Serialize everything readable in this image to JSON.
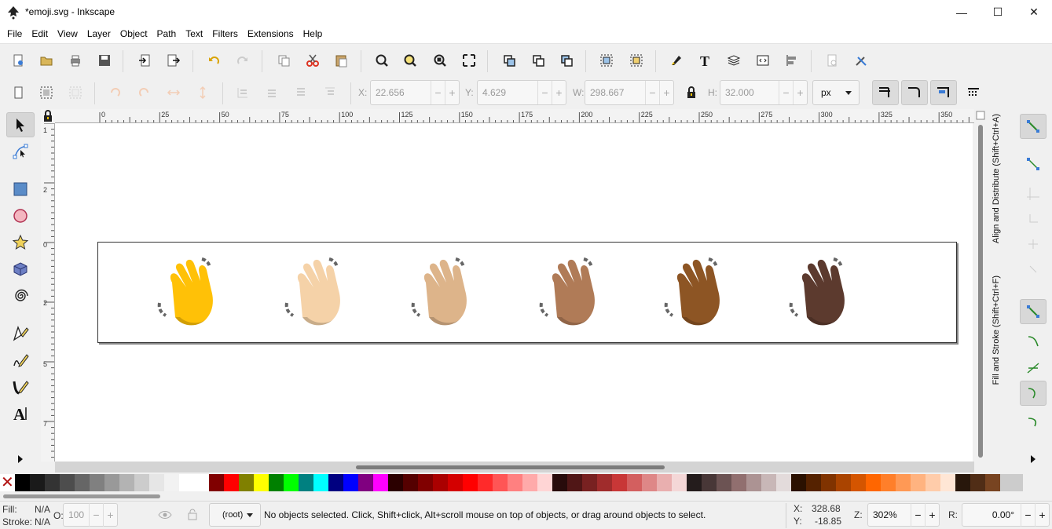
{
  "window": {
    "title": "*emoji.svg - Inkscape",
    "minimize_glyph": "—",
    "maximize_glyph": "☐",
    "close_glyph": "✕"
  },
  "menu": [
    "File",
    "Edit",
    "View",
    "Layer",
    "Object",
    "Path",
    "Text",
    "Filters",
    "Extensions",
    "Help"
  ],
  "controls": {
    "x": {
      "label": "X:",
      "value": "22.656"
    },
    "y": {
      "label": "Y:",
      "value": "4.629"
    },
    "w": {
      "label": "W:",
      "value": "298.667"
    },
    "h": {
      "label": "H:",
      "value": "32.000"
    },
    "unit": "px",
    "minus": "−",
    "plus": "+"
  },
  "ruler_top_labels": [
    "0",
    "25",
    "50",
    "75",
    "100",
    "125",
    "150",
    "175",
    "200",
    "225",
    "250",
    "275",
    "300",
    "325",
    "350"
  ],
  "ruler_left_labels": [
    "1",
    "2",
    "0",
    "2",
    "5",
    "7"
  ],
  "canvas": {
    "emoji_count": 6,
    "skin_tones": [
      "#FFC107",
      "#F5D2A8",
      "#DDB48A",
      "#B07B57",
      "#8D5524",
      "#5C3A2E"
    ]
  },
  "dock_tabs": {
    "align": "Align and Distribute (Shift+Ctrl+A)",
    "fill_stroke": "Fill and Stroke (Shift+Ctrl+F)"
  },
  "palette": {
    "none_glyph": "✕",
    "colors": [
      "#000000",
      "#1a1a1a",
      "#333333",
      "#4d4d4d",
      "#666666",
      "#808080",
      "#999999",
      "#b3b3b3",
      "#cccccc",
      "#e6e6e6",
      "#f2f2f2",
      "#ffffff",
      "#ffffff",
      "#800000",
      "#ff0000",
      "#808000",
      "#ffff00",
      "#008000",
      "#00ff00",
      "#008080",
      "#00ffff",
      "#000080",
      "#0000ff",
      "#800080",
      "#ff00ff",
      "#2b0000",
      "#550000",
      "#800000",
      "#aa0000",
      "#d40000",
      "#ff0000",
      "#ff2a2a",
      "#ff5555",
      "#ff8080",
      "#ffaaaa",
      "#ffd5d5",
      "#280b0b",
      "#501616",
      "#782121",
      "#a02c2c",
      "#c83737",
      "#d35f5f",
      "#de8787",
      "#e9afaf",
      "#f4d7d7",
      "#241c1c",
      "#483737",
      "#6c5353",
      "#916f6f",
      "#ac9393",
      "#c8b7b7",
      "#e3dbdb",
      "#2b1100",
      "#552200",
      "#803300",
      "#aa4400",
      "#d45500",
      "#ff6600",
      "#ff7f2a",
      "#ff9955",
      "#ffb380",
      "#ffccaa",
      "#ffe6d5",
      "#28170b",
      "#502d16",
      "#784421"
    ]
  },
  "status": {
    "fill_label": "Fill:",
    "fill_value": "N/A",
    "stroke_label": "Stroke:",
    "stroke_value": "N/A",
    "opacity_label": "O:",
    "opacity_value": "100",
    "layer": "(root)",
    "message": "No objects selected. Click, Shift+click, Alt+scroll mouse on top of objects, or drag around objects to select.",
    "cursor_x_label": "X:",
    "cursor_x": "328.68",
    "cursor_y_label": "Y:",
    "cursor_y": "-18.85",
    "zoom_label": "Z:",
    "zoom": "302%",
    "rotate_label": "R:",
    "rotate": "0.00°"
  }
}
